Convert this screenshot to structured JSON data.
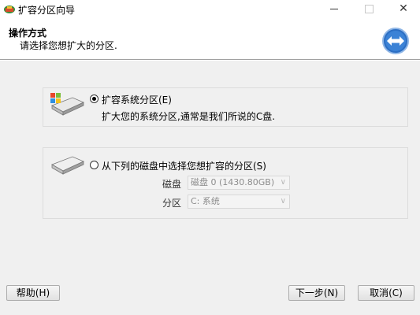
{
  "window": {
    "title": "扩容分区向导",
    "minimize_label": "—",
    "maximize_label": "□",
    "close_label": "✕"
  },
  "header": {
    "title": "操作方式",
    "subtitle": "请选择您想扩大的分区."
  },
  "options": {
    "system_partition": {
      "label": "扩容系统分区(E)",
      "description": "扩大您的系统分区,通常是我们所说的C盘.",
      "selected": true
    },
    "choose_partition": {
      "label": "从下列的磁盘中选择您想扩容的分区(S)",
      "selected": false,
      "disk_label": "磁盘",
      "disk_value": "磁盘 0 (1430.80GB)",
      "partition_label": "分区",
      "partition_value": "C: 系统"
    }
  },
  "buttons": {
    "help": "帮助(H)",
    "next": "下一步(N)",
    "cancel": "取消(C)"
  },
  "colors": {
    "background": "#f0f0f0",
    "header_bg": "#ffffff",
    "accent_icon": "#1a5fb4"
  }
}
